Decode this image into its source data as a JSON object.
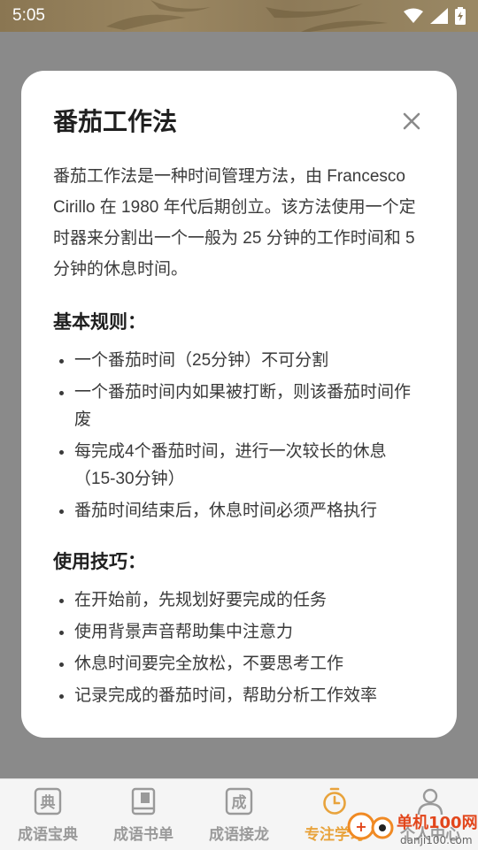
{
  "status_bar": {
    "time": "5:05"
  },
  "modal": {
    "title": "番茄工作法",
    "intro": "番茄工作法是一种时间管理方法，由 Francesco Cirillo 在 1980 年代后期创立。该方法使用一个定时器来分割出一个一般为 25 分钟的工作时间和 5 分钟的休息时间。",
    "rules_title": "基本规则：",
    "rules": [
      "一个番茄时间（25分钟）不可分割",
      "一个番茄时间内如果被打断，则该番茄时间作废",
      "每完成4个番茄时间，进行一次较长的休息（15-30分钟）",
      "番茄时间结束后，休息时间必须严格执行"
    ],
    "tips_title": "使用技巧：",
    "tips": [
      "在开始前，先规划好要完成的任务",
      "使用背景声音帮助集中注意力",
      "休息时间要完全放松，不要思考工作",
      "记录完成的番茄时间，帮助分析工作效率"
    ]
  },
  "bottom_nav": {
    "items": [
      {
        "label": "成语宝典",
        "icon": "dictionary-icon",
        "glyph": "典"
      },
      {
        "label": "成语书单",
        "icon": "book-icon"
      },
      {
        "label": "成语接龙",
        "icon": "chain-icon",
        "glyph": "成"
      },
      {
        "label": "专注学习",
        "icon": "timer-icon"
      },
      {
        "label": "个人中心",
        "icon": "user-icon"
      }
    ],
    "active_index": 3
  },
  "watermark": {
    "text": "单机100网",
    "url": "danji100.com"
  },
  "colors": {
    "accent": "#e8a33c",
    "inactive": "#9a9a9a",
    "overlay": "#8a8a8a"
  }
}
